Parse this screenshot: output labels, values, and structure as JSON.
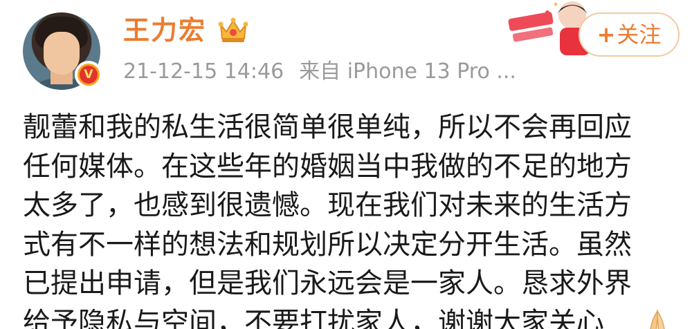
{
  "user": {
    "name": "王力宏",
    "verified_badge": "V"
  },
  "meta": {
    "timestamp": "21-12-15 14:46",
    "source": "来自 iPhone 13 Pro ..."
  },
  "follow_button": {
    "plus": "+",
    "label": "关注"
  },
  "content": {
    "lines": [
      "靓蕾和我的私生活很简单很单纯，所以不会再回应",
      "任何媒体。在这些年的婚姻当中我做的不足的地方",
      "太多了，也感到很遗憾。现在我们对未来的生活方",
      "式有不一样的想法和规划所以决定分开生活。虽然",
      "已提出申请，但是我们永远会是一家人。恳求外界",
      "给予隐私与空间，不要打扰家人，谢谢大家关心"
    ]
  },
  "icons": {
    "crown": "crown-icon",
    "verified": "verified-badge-icon",
    "pray": "pray-emoji-icon",
    "decoration": "celebration-decoration"
  },
  "colors": {
    "name": "#eb7c30",
    "meta": "#9a9a9a",
    "follow_border": "#f3c9a0",
    "text": "#1a1a1a"
  }
}
